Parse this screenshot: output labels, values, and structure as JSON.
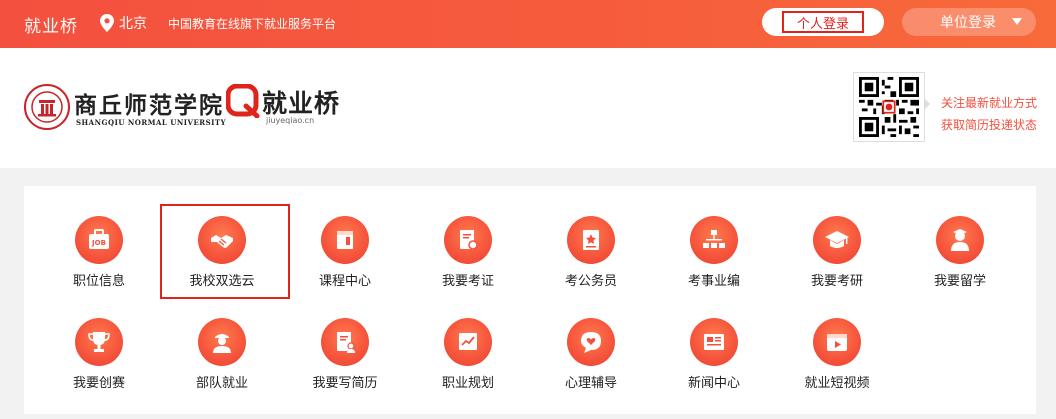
{
  "topbar": {
    "brand": "就业桥",
    "location": "北京",
    "slogan": "中国教育在线旗下就业服务平台",
    "personal_login": "个人登录",
    "unit_login": "单位登录"
  },
  "header": {
    "school_name_cn": "商丘师范学院",
    "school_name_en": "SHANGQIU NORMAL UNIVERSITY",
    "platform_name": "就业桥",
    "platform_url": "jiuyeqiao.cn",
    "follow_lines": [
      "关注最新就业方式",
      "获取简历投递状态"
    ]
  },
  "tiles": [
    {
      "label": "职位信息",
      "icon": "job-icon"
    },
    {
      "label": "我校双选云",
      "icon": "handshake-icon"
    },
    {
      "label": "课程中心",
      "icon": "book-icon"
    },
    {
      "label": "我要考证",
      "icon": "certificate-icon"
    },
    {
      "label": "考公务员",
      "icon": "document-star-icon"
    },
    {
      "label": "考事业编",
      "icon": "org-chart-icon"
    },
    {
      "label": "我要考研",
      "icon": "graduation-cap-icon"
    },
    {
      "label": "我要留学",
      "icon": "student-icon"
    },
    {
      "label": "我要创赛",
      "icon": "trophy-icon"
    },
    {
      "label": "部队就业",
      "icon": "soldier-icon"
    },
    {
      "label": "我要写简历",
      "icon": "resume-icon"
    },
    {
      "label": "职业规划",
      "icon": "chart-board-icon"
    },
    {
      "label": "心理辅导",
      "icon": "heart-chat-icon"
    },
    {
      "label": "新闻中心",
      "icon": "newspaper-icon"
    },
    {
      "label": "就业短视频",
      "icon": "video-icon"
    }
  ],
  "colors": {
    "brand": "#f4503f",
    "highlight": "#e0241c"
  }
}
